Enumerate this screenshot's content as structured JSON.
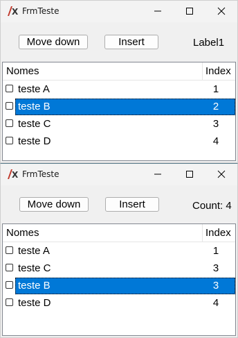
{
  "windows": [
    {
      "title": "FrmTeste",
      "buttons": {
        "move_down": "Move down",
        "insert": "Insert"
      },
      "label": "Label1",
      "columns": {
        "nomes": "Nomes",
        "index": "Index"
      },
      "rows": [
        {
          "name": "teste A",
          "index": "1",
          "selected": false
        },
        {
          "name": "teste B",
          "index": "2",
          "selected": true
        },
        {
          "name": "teste C",
          "index": "3",
          "selected": false
        },
        {
          "name": "teste D",
          "index": "4",
          "selected": false
        }
      ]
    },
    {
      "title": "FrmTeste",
      "buttons": {
        "move_down": "Move down",
        "insert": "Insert"
      },
      "label": "Count: 4",
      "columns": {
        "nomes": "Nomes",
        "index": "Index"
      },
      "rows": [
        {
          "name": "teste A",
          "index": "1",
          "selected": false
        },
        {
          "name": "teste C",
          "index": "3",
          "selected": false
        },
        {
          "name": "teste B",
          "index": "3",
          "selected": true
        },
        {
          "name": "teste D",
          "index": "4",
          "selected": false
        }
      ]
    }
  ],
  "colors": {
    "selection": "#0078d7",
    "window_bg": "#f0f0f0"
  },
  "icons": {
    "app": "lazarus-icon",
    "minimize": "minimize-icon",
    "maximize": "maximize-icon",
    "close": "close-icon"
  }
}
